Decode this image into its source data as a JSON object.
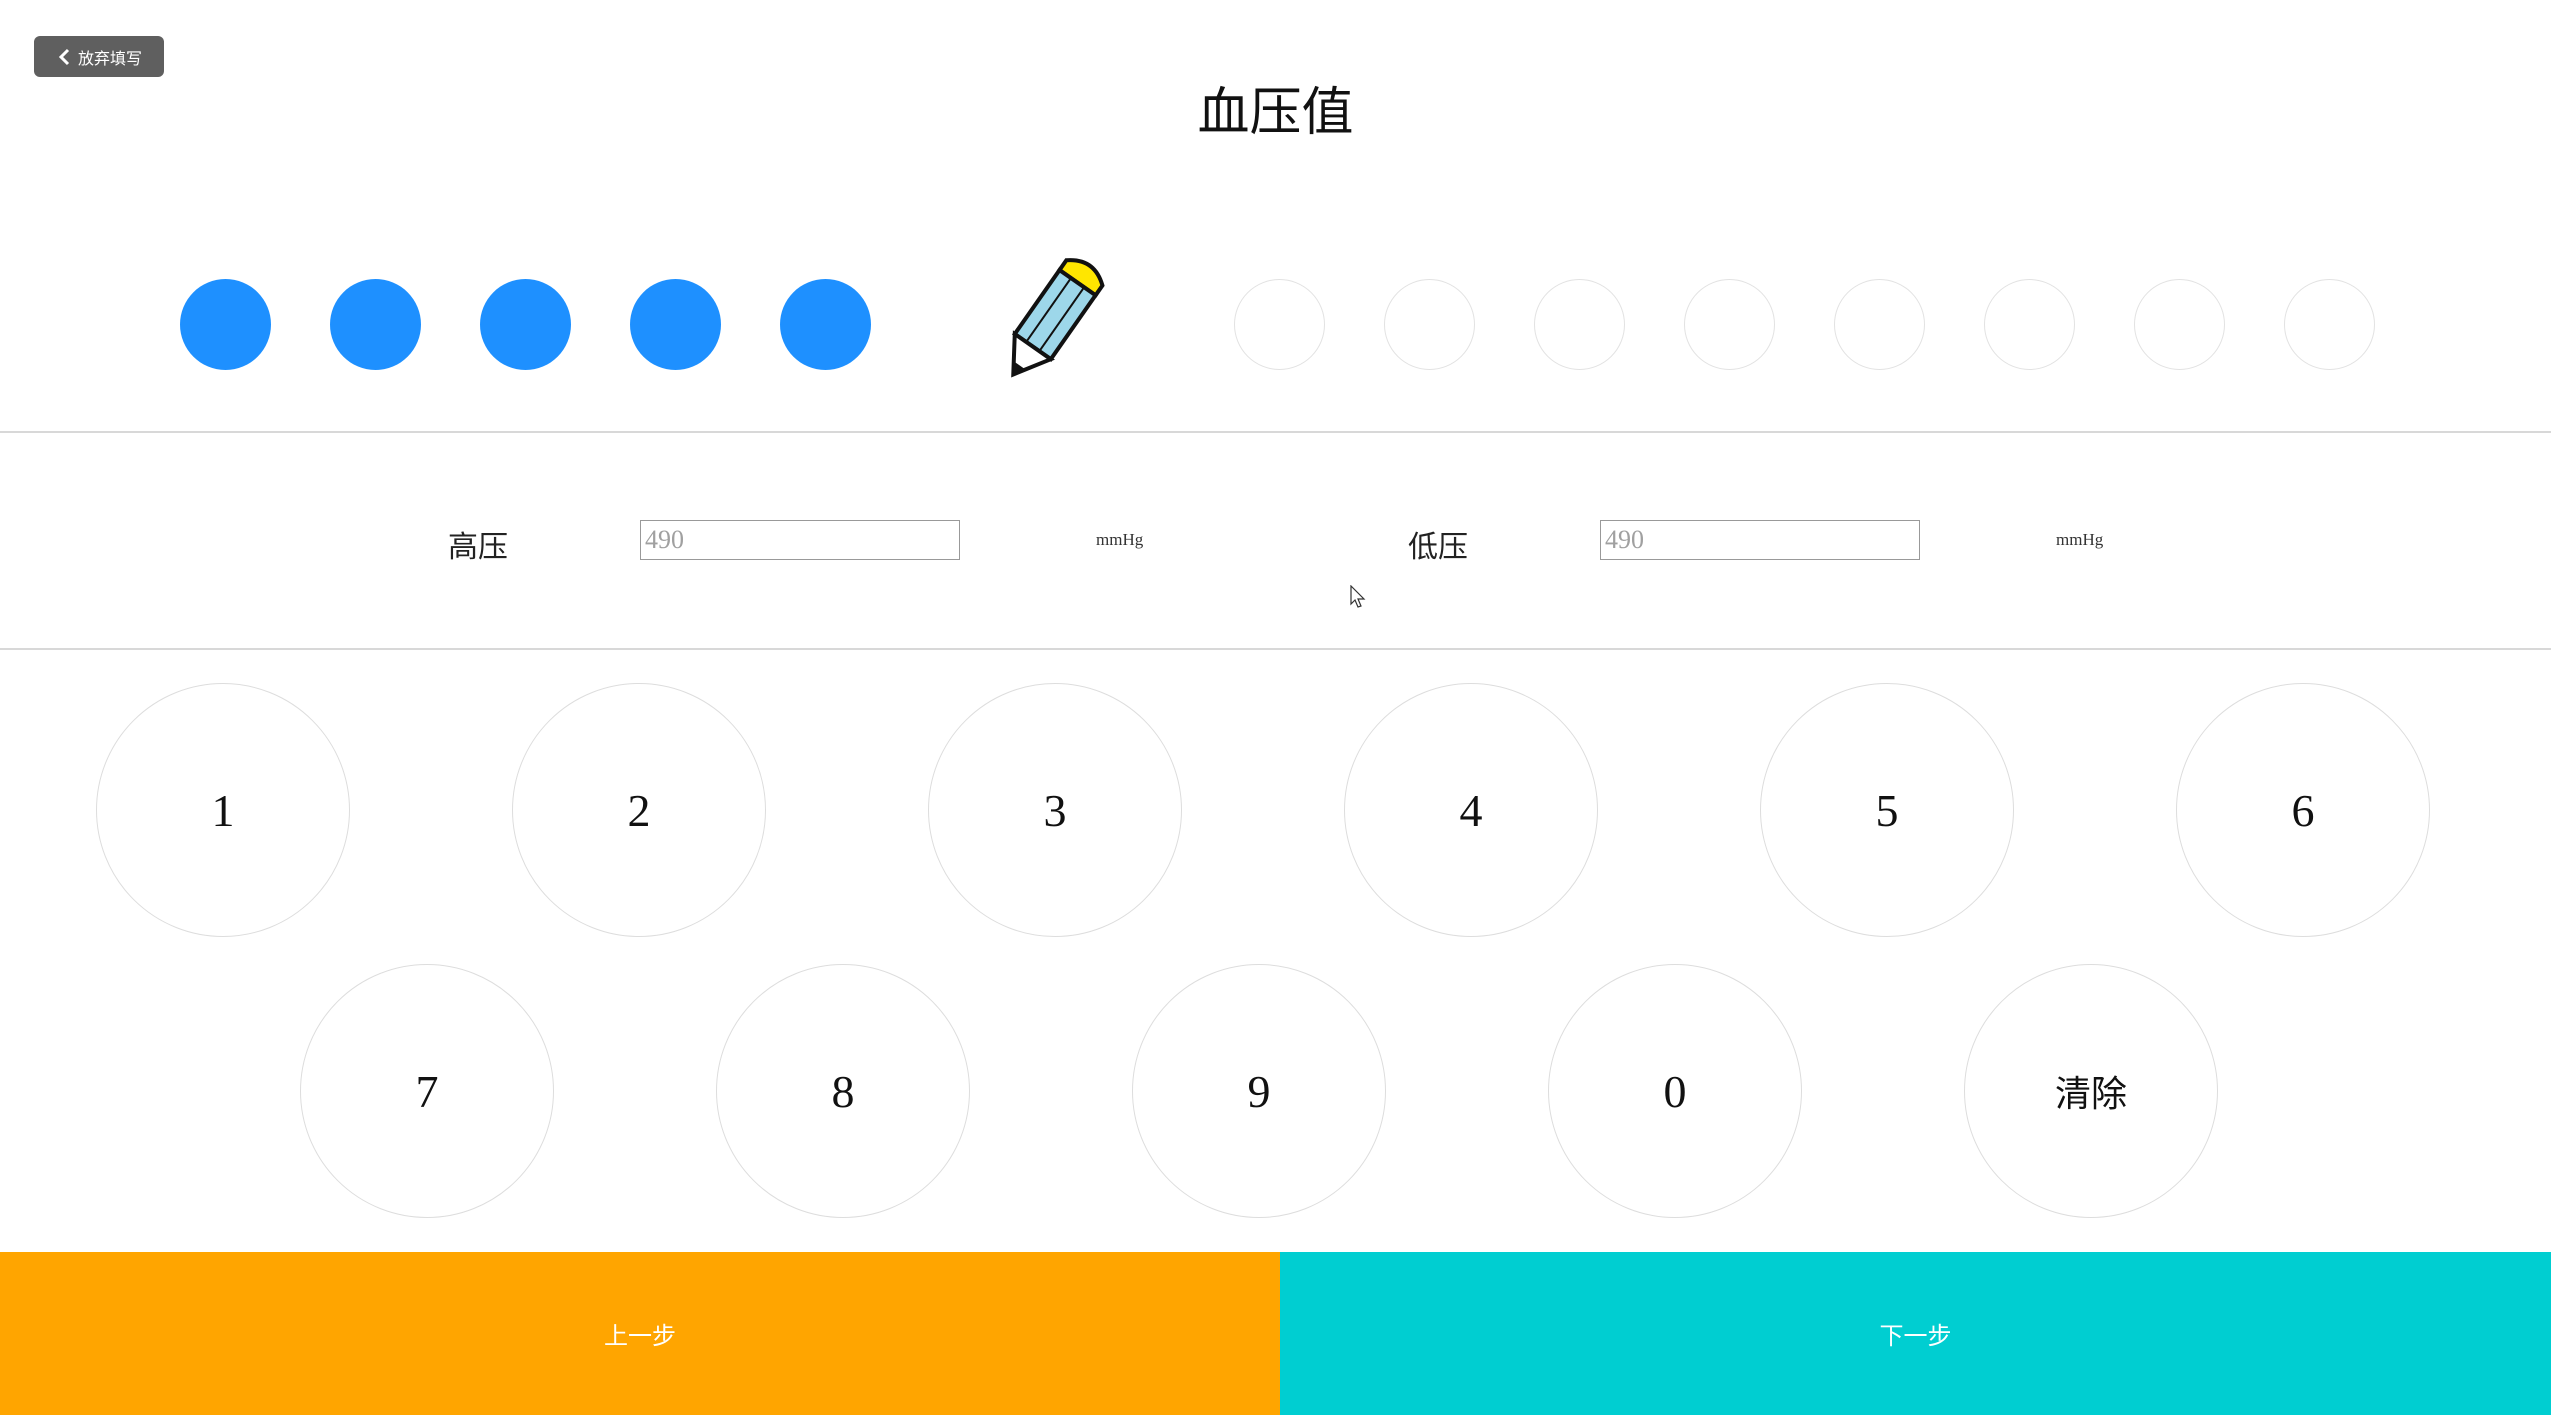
{
  "header": {
    "back_label": "放弃填写",
    "title": "血压值"
  },
  "progress": {
    "completed_steps": 5,
    "current_step": 6,
    "remaining_steps": 8,
    "done_color": "#1e90ff",
    "current_icon": "pencil-icon"
  },
  "fields": {
    "systolic": {
      "label": "高压",
      "placeholder": "490",
      "value": "",
      "unit": "mmHg"
    },
    "diastolic": {
      "label": "低压",
      "placeholder": "490",
      "value": "",
      "unit": "mmHg"
    }
  },
  "keypad": {
    "row1": [
      "1",
      "2",
      "3",
      "4",
      "5",
      "6"
    ],
    "row2": [
      "7",
      "8",
      "9",
      "0",
      "清除"
    ]
  },
  "footer": {
    "prev_label": "上一步",
    "next_label": "下一步",
    "prev_color": "#ffa500",
    "next_color": "#00ced1"
  }
}
